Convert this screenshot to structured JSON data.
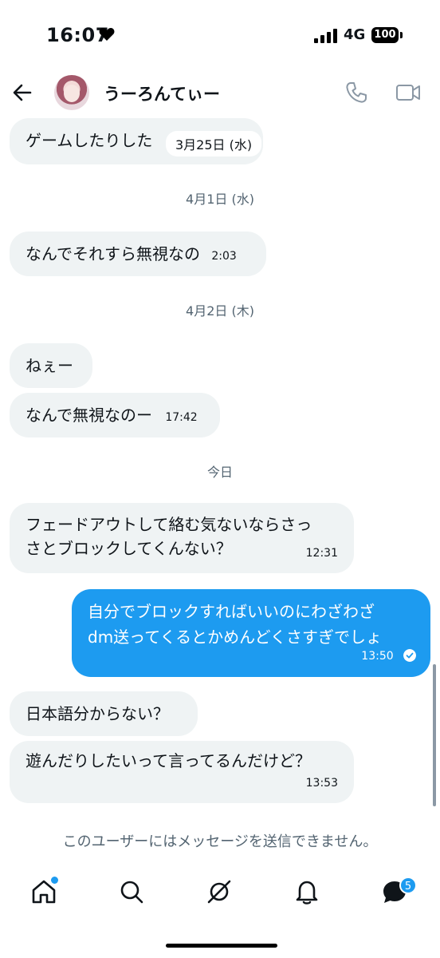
{
  "status_bar": {
    "time": "16:07",
    "network": "4G",
    "battery": "100"
  },
  "header": {
    "contact_name": "うーろんてぃー"
  },
  "conversation": {
    "partial_message": {
      "text": "ゲームしたりした",
      "date_chip": "3月25日 (水)"
    },
    "date_1": "4月1日 (水)",
    "msg_1": {
      "text": "なんでそれすら無視なの",
      "time": "2:03"
    },
    "date_2": "4月2日 (木)",
    "msg_2": {
      "text": "ねぇー"
    },
    "msg_3": {
      "text": "なんで無視なのー",
      "time": "17:42"
    },
    "date_3": "今日",
    "msg_4": {
      "line1": "フェードアウトして絡む気ないならさっ",
      "line2": "さとブロックしてくんない？",
      "time": "12:31"
    },
    "msg_5": {
      "line1": "自分でブロックすればいいのにわざわざ",
      "line2": "dm送ってくるとかめんどくさすぎでしょ",
      "time": "13:50"
    },
    "msg_6": {
      "text": "日本語分からない？"
    },
    "msg_7": {
      "text": "遊んだりしたいって言ってるんだけど？",
      "time": "13:53"
    }
  },
  "notice": "このユーザーにはメッセージを送信できません。",
  "bottom_nav": {
    "items": [
      "home-icon",
      "search-icon",
      "grok-icon",
      "bell-icon",
      "messages-icon"
    ],
    "messages_badge": "5"
  },
  "colors": {
    "accent": "#1d9bf0",
    "incoming_bubble": "#eff3f4",
    "muted_text": "#536471"
  }
}
